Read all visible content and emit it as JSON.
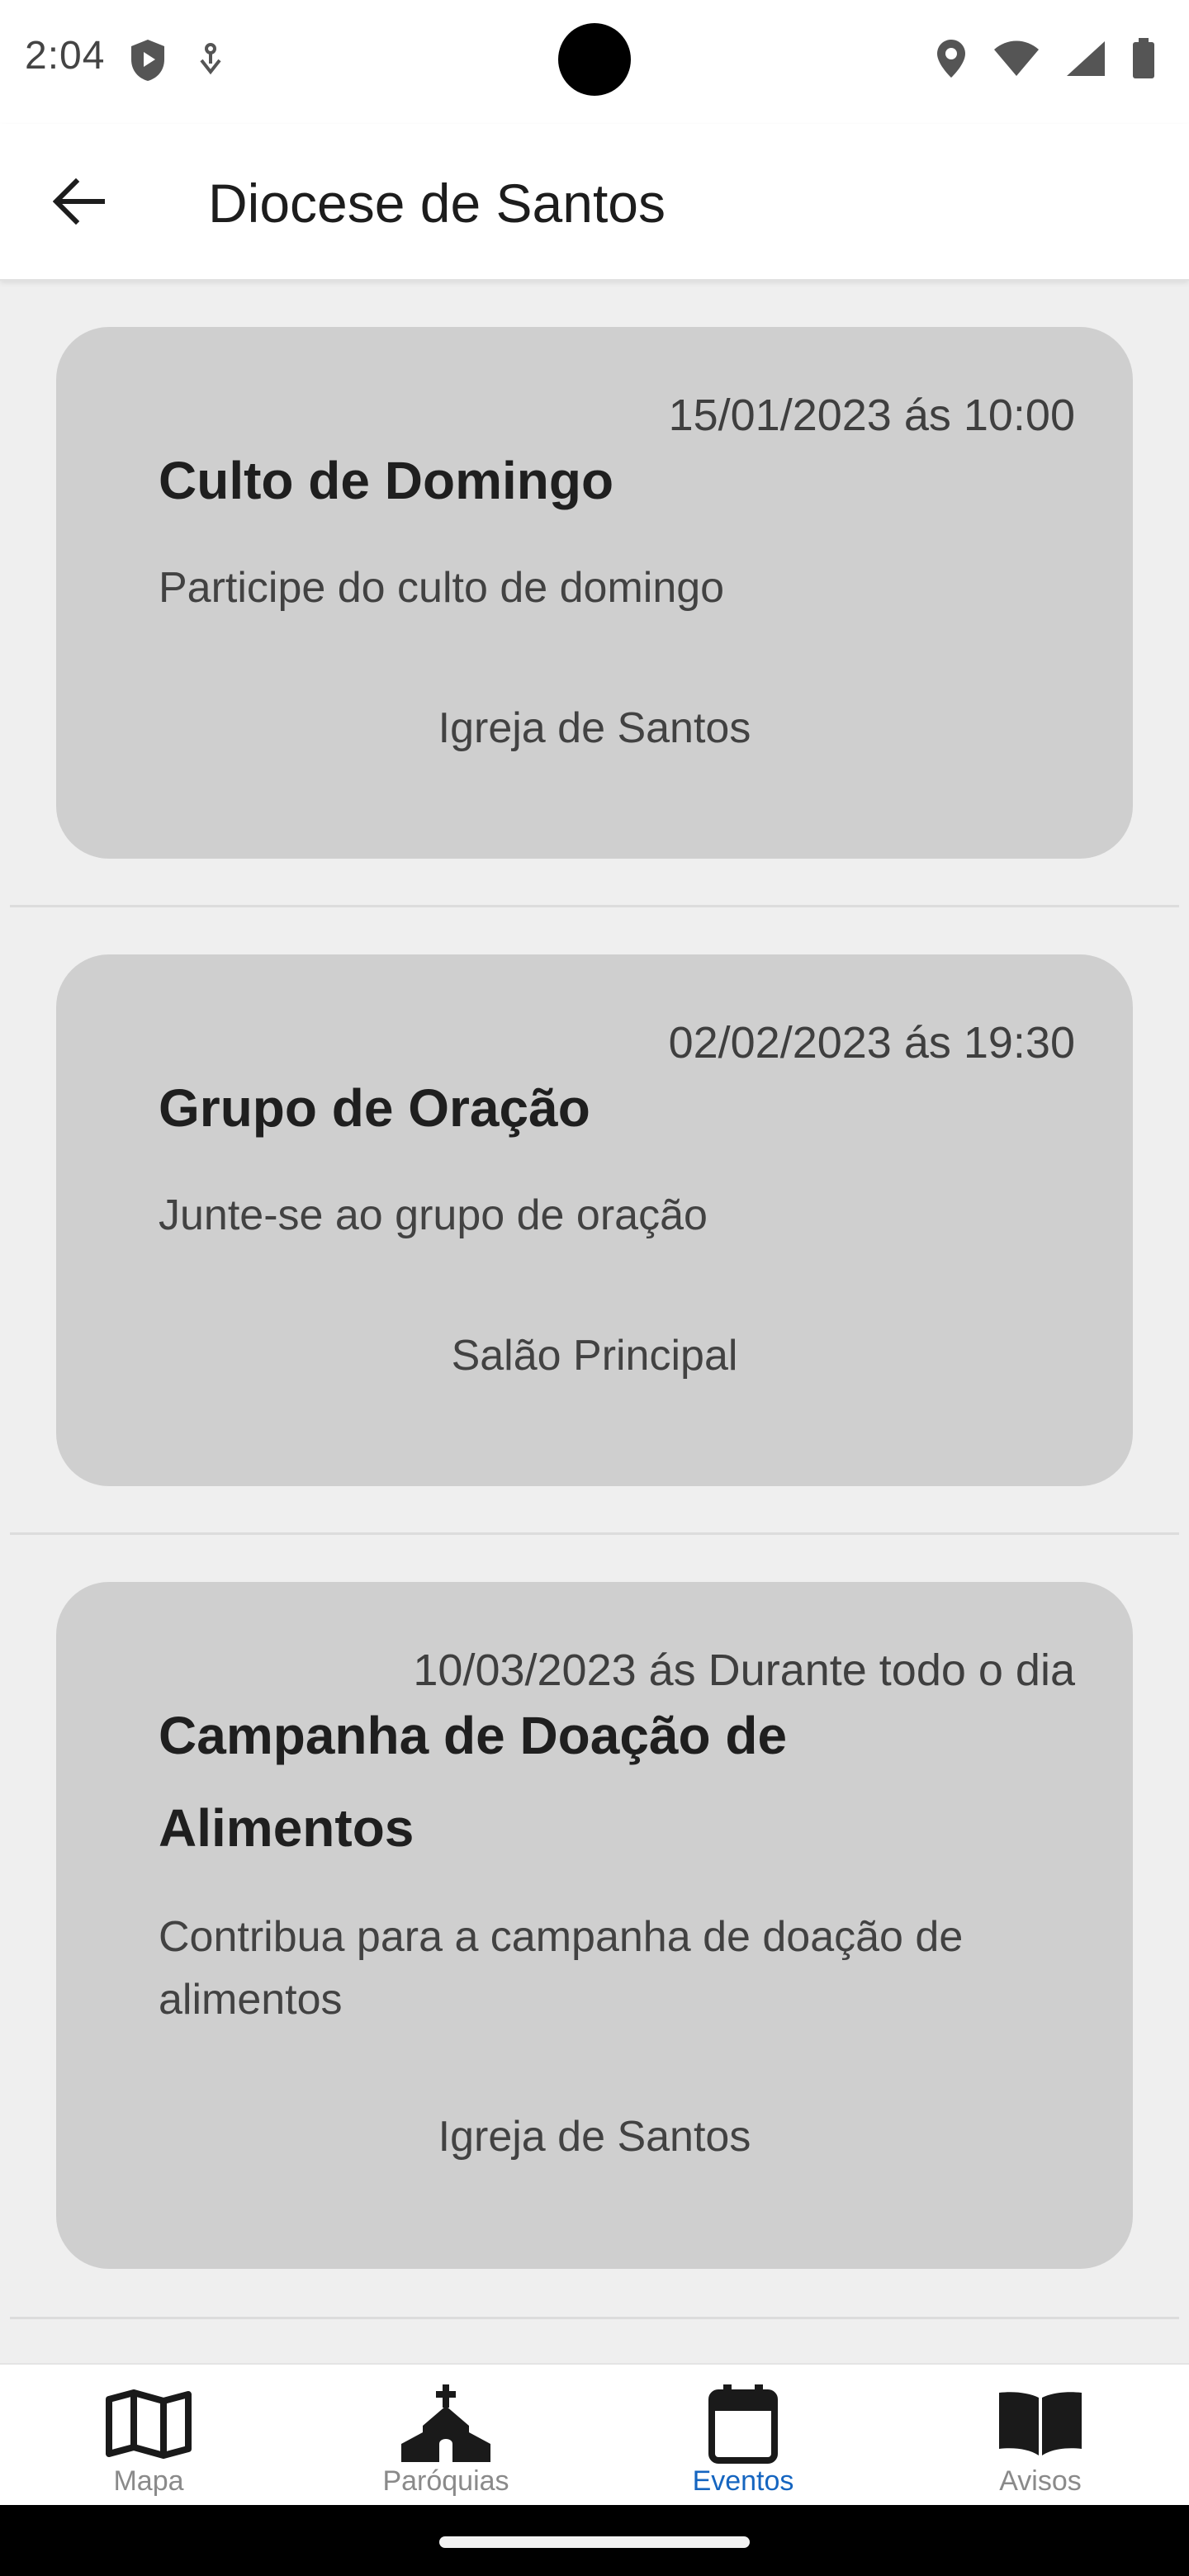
{
  "status_bar": {
    "time": "2:04"
  },
  "app_bar": {
    "title": "Diocese de Santos"
  },
  "events": [
    {
      "date": "15/01/2023 ás 10:00",
      "title": "Culto de Domingo",
      "description": "Participe do culto de domingo",
      "location": "Igreja de Santos"
    },
    {
      "date": "02/02/2023 ás 19:30",
      "title": "Grupo de Oração",
      "description": "Junte-se ao grupo de oração",
      "location": "Salão Principal"
    },
    {
      "date": "10/03/2023 ás Durante todo o dia",
      "title": "Campanha de Doação de Alimentos",
      "description": "Contribua para a campanha de doação de alimentos",
      "location": "Igreja de Santos"
    }
  ],
  "bottom_nav": {
    "items": [
      {
        "label": "Mapa",
        "icon": "map-icon"
      },
      {
        "label": "Paróquias",
        "icon": "church-icon"
      },
      {
        "label": "Eventos",
        "icon": "calendar-icon",
        "active": true
      },
      {
        "label": "Avisos",
        "icon": "book-icon"
      }
    ],
    "active_color": "#1565c0",
    "inactive_color": "#8a8a8a"
  },
  "colors": {
    "card_background": "#cfcfcf",
    "page_background": "#efefef"
  }
}
